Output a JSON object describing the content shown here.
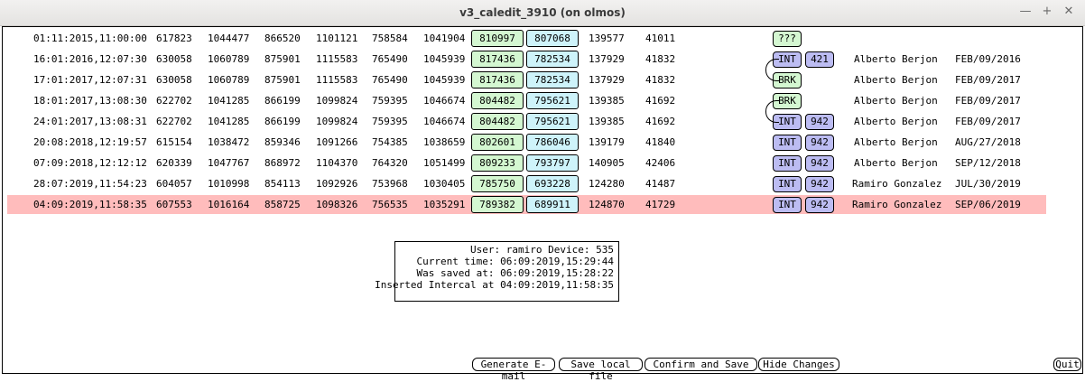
{
  "window": {
    "title": "v3_caledit_3910 (on olmos)",
    "minimize_glyph": "—",
    "maximize_glyph": "+",
    "close_glyph": "✕"
  },
  "rows": [
    {
      "time": "01:11:2015,11:00:00",
      "c1": "617823",
      "c2": "1044477",
      "c3": "866520",
      "c4": "1101121",
      "c5": "758584",
      "c6": "1041904",
      "g": "810997",
      "b": "807068",
      "c7": "139577",
      "c8": "41011",
      "tag": "???",
      "num": "",
      "user": "",
      "date": ""
    },
    {
      "time": "16:01:2016,12:07:30",
      "c1": "630058",
      "c2": "1060789",
      "c3": "875901",
      "c4": "1115583",
      "c5": "765490",
      "c6": "1045939",
      "g": "817436",
      "b": "782534",
      "c7": "137929",
      "c8": "41832",
      "tag": "INT",
      "num": "421",
      "user": "Alberto Berjon",
      "date": "FEB/09/2016"
    },
    {
      "time": "17:01:2017,12:07:31",
      "c1": "630058",
      "c2": "1060789",
      "c3": "875901",
      "c4": "1115583",
      "c5": "765490",
      "c6": "1045939",
      "g": "817436",
      "b": "782534",
      "c7": "137929",
      "c8": "41832",
      "tag": "BRK",
      "num": "",
      "user": "Alberto Berjon",
      "date": "FEB/09/2017"
    },
    {
      "time": "18:01:2017,13:08:30",
      "c1": "622702",
      "c2": "1041285",
      "c3": "866199",
      "c4": "1099824",
      "c5": "759395",
      "c6": "1046674",
      "g": "804482",
      "b": "795621",
      "c7": "139385",
      "c8": "41692",
      "tag": "BRK",
      "num": "",
      "user": "Alberto Berjon",
      "date": "FEB/09/2017"
    },
    {
      "time": "24:01:2017,13:08:31",
      "c1": "622702",
      "c2": "1041285",
      "c3": "866199",
      "c4": "1099824",
      "c5": "759395",
      "c6": "1046674",
      "g": "804482",
      "b": "795621",
      "c7": "139385",
      "c8": "41692",
      "tag": "INT",
      "num": "942",
      "user": "Alberto Berjon",
      "date": "FEB/09/2017"
    },
    {
      "time": "20:08:2018,12:19:57",
      "c1": "615154",
      "c2": "1038472",
      "c3": "859346",
      "c4": "1091266",
      "c5": "754385",
      "c6": "1038659",
      "g": "802601",
      "b": "786046",
      "c7": "139179",
      "c8": "41840",
      "tag": "INT",
      "num": "942",
      "user": "Alberto Berjon",
      "date": "AUG/27/2018"
    },
    {
      "time": "07:09:2018,12:12:12",
      "c1": "620339",
      "c2": "1047767",
      "c3": "868972",
      "c4": "1104370",
      "c5": "764320",
      "c6": "1051499",
      "g": "809233",
      "b": "793797",
      "c7": "140905",
      "c8": "42406",
      "tag": "INT",
      "num": "942",
      "user": "Alberto Berjon",
      "date": "SEP/12/2018"
    },
    {
      "time": "28:07:2019,11:54:23",
      "c1": "604057",
      "c2": "1010998",
      "c3": "854113",
      "c4": "1092926",
      "c5": "753968",
      "c6": "1030405",
      "g": "785750",
      "b": "693228",
      "c7": "124280",
      "c8": "41487",
      "tag": "INT",
      "num": "942",
      "user": "Ramiro Gonzalez",
      "date": "JUL/30/2019"
    },
    {
      "time": "04:09:2019,11:58:35",
      "c1": "607553",
      "c2": "1016164",
      "c3": "858725",
      "c4": "1098326",
      "c5": "756535",
      "c6": "1035291",
      "g": "789382",
      "b": "689911",
      "c7": "124870",
      "c8": "41729",
      "tag": "INT",
      "num": "942",
      "user": "Ramiro Gonzalez",
      "date": "SEP/06/2019"
    }
  ],
  "info": {
    "line1": "User: ramiro Device: 535",
    "line2": "Current time: 06:09:2019,15:29:44",
    "line3": "Was saved at: 06:09:2019,15:28:22",
    "line4": "Inserted Intercal at 04:09:2019,11:58:35"
  },
  "buttons": {
    "email": "Generate E-mail",
    "save_local": "Save local file",
    "confirm": "Confirm and Save",
    "hide": "Hide Changes",
    "quit": "Quit"
  },
  "colors": {
    "selected_row": "#ffbcbc",
    "green_box": "#d4f7d1",
    "blue_box": "#cef3fa",
    "int_tag": "#bcbcf2"
  }
}
